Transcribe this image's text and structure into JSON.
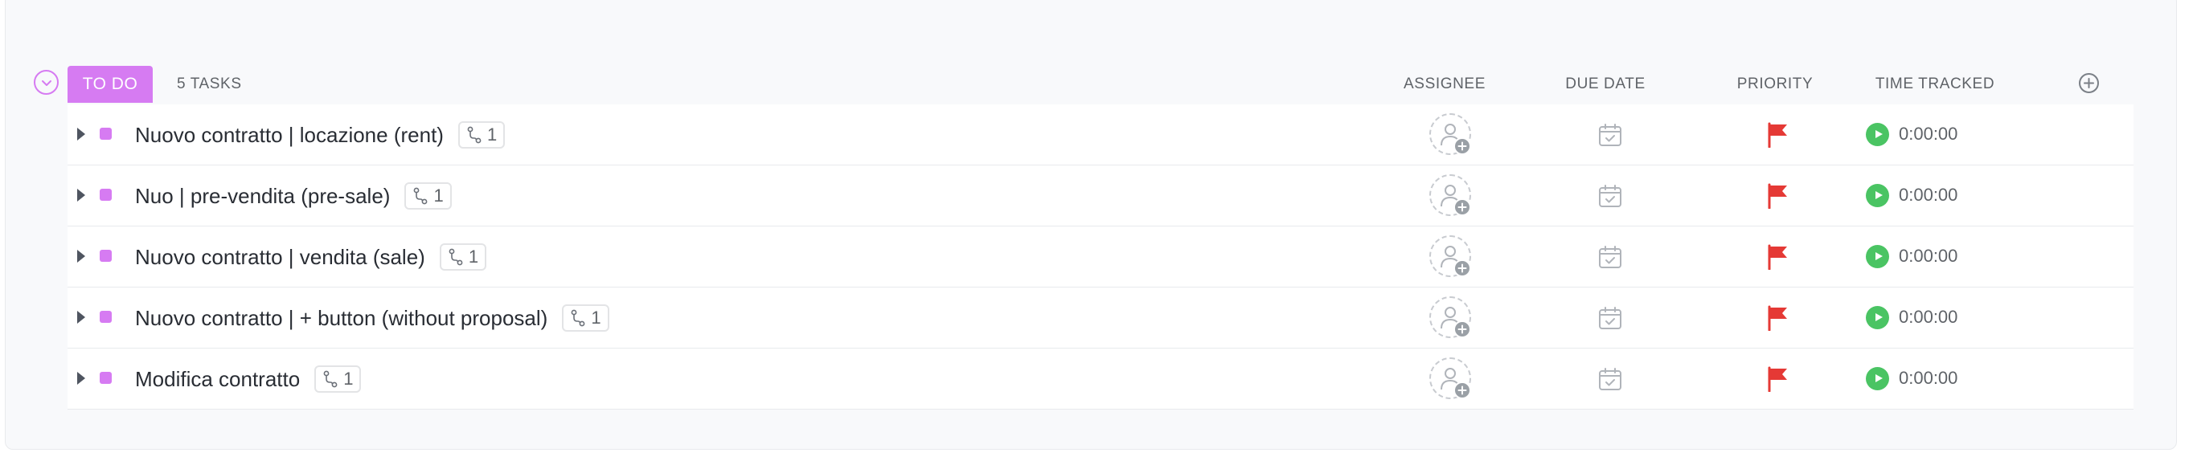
{
  "group": {
    "status_label": "TO DO",
    "task_count": "5 TASKS",
    "status_color": "#d67bf2"
  },
  "columns": {
    "assignee": "ASSIGNEE",
    "due_date": "DUE DATE",
    "priority": "PRIORITY",
    "time_tracked": "TIME TRACKED"
  },
  "tasks": [
    {
      "name": "Nuovo contratto | locazione (rent)",
      "subtasks": "1",
      "priority_color": "#e53935",
      "time": "0:00:00"
    },
    {
      "name": "Nuo | pre-vendita (pre-sale)",
      "subtasks": "1",
      "priority_color": "#e53935",
      "time": "0:00:00"
    },
    {
      "name": "Nuovo contratto | vendita (sale)",
      "subtasks": "1",
      "priority_color": "#e53935",
      "time": "0:00:00"
    },
    {
      "name": "Nuovo contratto | + button (without proposal)",
      "subtasks": "1",
      "priority_color": "#e53935",
      "time": "0:00:00"
    },
    {
      "name": "Modifica contratto",
      "subtasks": "1",
      "priority_color": "#e53935",
      "time": "0:00:00"
    }
  ],
  "icons": {
    "collapse": "chevron-down-icon",
    "add_column": "plus-circle-icon",
    "subtask": "subtask-icon",
    "assignee": "add-assignee-icon",
    "due_date": "calendar-check-icon",
    "priority": "flag-icon",
    "timer": "play-icon"
  },
  "colors": {
    "timer_green": "#4ac463",
    "urgent_red": "#e53935"
  }
}
